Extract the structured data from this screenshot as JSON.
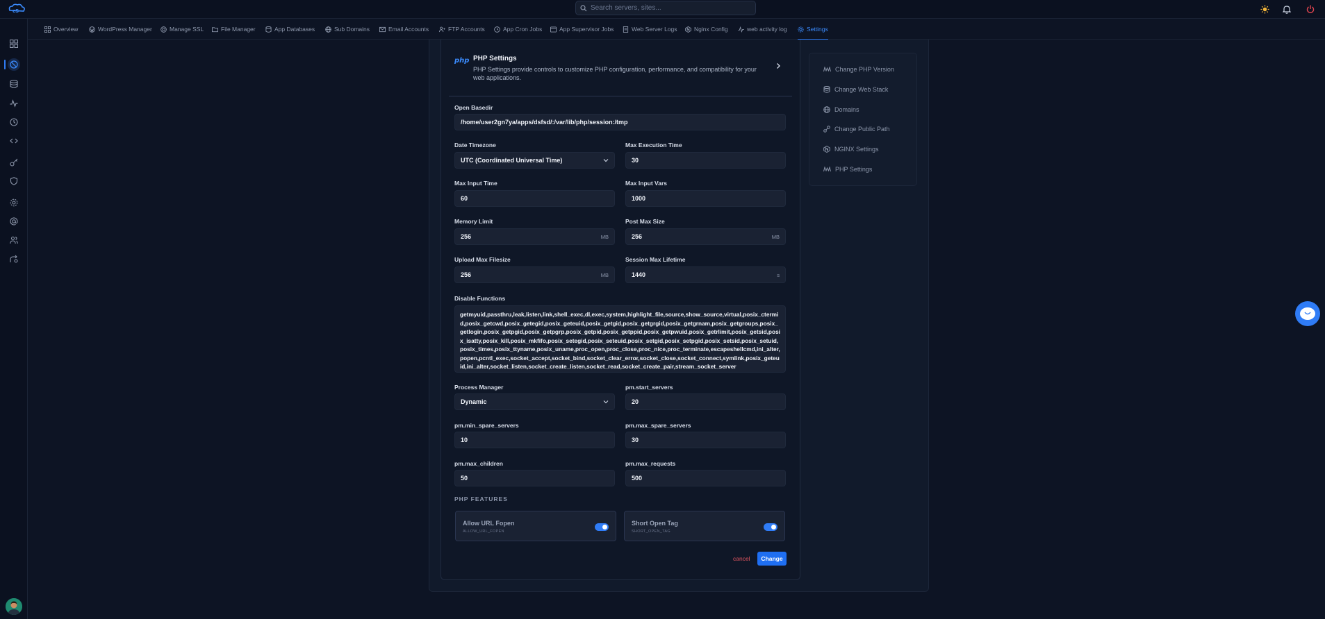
{
  "search": {
    "placeholder": "Search servers, sites..."
  },
  "tabs": [
    {
      "label": "Overview",
      "icon": "overview-icon"
    },
    {
      "label": "WordPress Manager",
      "icon": "wordpress-icon"
    },
    {
      "label": "Manage SSL",
      "icon": "ssl-icon"
    },
    {
      "label": "File Manager",
      "icon": "folder-icon"
    },
    {
      "label": "App Databases",
      "icon": "database-icon"
    },
    {
      "label": "Sub Domains",
      "icon": "globe-icon"
    },
    {
      "label": "Email Accounts",
      "icon": "mail-icon"
    },
    {
      "label": "FTP Accounts",
      "icon": "users-icon"
    },
    {
      "label": "App Cron Jobs",
      "icon": "clock-icon"
    },
    {
      "label": "App Supervisor Jobs",
      "icon": "supervisor-icon"
    },
    {
      "label": "Web Server Logs",
      "icon": "document-icon"
    },
    {
      "label": "Nginx Config",
      "icon": "nginx-icon"
    },
    {
      "label": "web activity log",
      "icon": "activity-icon"
    },
    {
      "label": "Settings",
      "icon": "gear-icon",
      "active": true
    }
  ],
  "header": {
    "logo": "php",
    "title": "PHP Settings",
    "description": "PHP Settings provide controls to customize PHP configuration, performance, and compatibility for your web applications."
  },
  "form": {
    "open_basedir": {
      "label": "Open Basedir",
      "value": "/home/user2gn7ya/apps/dsfsd/:/var/lib/php/session:/tmp"
    },
    "date_timezone": {
      "label": "Date Timezone",
      "value": "UTC (Coordinated Universal Time)"
    },
    "max_execution_time": {
      "label": "Max Execution Time",
      "value": "30"
    },
    "max_input_time": {
      "label": "Max Input Time",
      "value": "60"
    },
    "max_input_vars": {
      "label": "Max Input Vars",
      "value": "1000"
    },
    "memory_limit": {
      "label": "Memory Limit",
      "value": "256",
      "unit": "MB"
    },
    "post_max_size": {
      "label": "Post Max Size",
      "value": "256",
      "unit": "MB"
    },
    "upload_max_filesize": {
      "label": "Upload Max Filesize",
      "value": "256",
      "unit": "MB"
    },
    "session_max_lifetime": {
      "label": "Session Max Lifetime",
      "value": "1440",
      "unit": "s"
    },
    "disable_functions": {
      "label": "Disable Functions",
      "value": "getmyuid,passthru,leak,listen,link,shell_exec,dl,exec,system,highlight_file,source,show_source,virtual,posix_ctermid,posix_getcwd,posix_getegid,posix_geteuid,posix_getgid,posix_getgrgid,posix_getgrnam,posix_getgroups,posix_getlogin,posix_getpgid,posix_getpgrp,posix_getpid,posix_getppid,posix_getpwuid,posix_getrlimit,posix_getsid,posix_isatty,posix_kill,posix_mkfifo,posix_setegid,posix_seteuid,posix_setgid,posix_setpgid,posix_setsid,posix_setuid,posix_times,posix_ttyname,posix_uname,proc_open,proc_close,proc_nice,proc_terminate,escapeshellcmd,ini_alter,popen,pcntl_exec,socket_accept,socket_bind,socket_clear_error,socket_close,socket_connect,symlink,posix_geteuid,ini_alter,socket_listen,socket_create_listen,socket_read,socket_create_pair,stream_socket_server"
    },
    "process_manager": {
      "label": "Process Manager",
      "value": "Dynamic"
    },
    "pm_start_servers": {
      "label": "pm.start_servers",
      "value": "20"
    },
    "pm_min_spare_servers": {
      "label": "pm.min_spare_servers",
      "value": "10"
    },
    "pm_max_spare_servers": {
      "label": "pm.max_spare_servers",
      "value": "30"
    },
    "pm_max_children": {
      "label": "pm.max_children",
      "value": "50"
    },
    "pm_max_requests": {
      "label": "pm.max_requests",
      "value": "500"
    }
  },
  "features": {
    "title": "PHP FEATURES",
    "items": [
      {
        "label": "Allow URL Fopen",
        "sub": "ALLOW_URL_FOPEN",
        "enabled": true
      },
      {
        "label": "Short Open Tag",
        "sub": "SHORT_OPEN_TAG",
        "enabled": true
      }
    ]
  },
  "actions": {
    "cancel": "cancel",
    "change": "Change"
  },
  "right_nav": [
    {
      "label": "Change PHP Version",
      "icon": "php-icon"
    },
    {
      "label": "Change Web Stack",
      "icon": "stack-icon"
    },
    {
      "label": "Domains",
      "icon": "globe-icon"
    },
    {
      "label": "Change Public Path",
      "icon": "link-icon"
    },
    {
      "label": "NGINX Settings",
      "icon": "nginx-icon"
    },
    {
      "label": "PHP Settings",
      "icon": "php-icon"
    }
  ],
  "colors": {
    "accent": "#2f7cf6",
    "danger": "#e05560",
    "background": "#0d1424"
  }
}
